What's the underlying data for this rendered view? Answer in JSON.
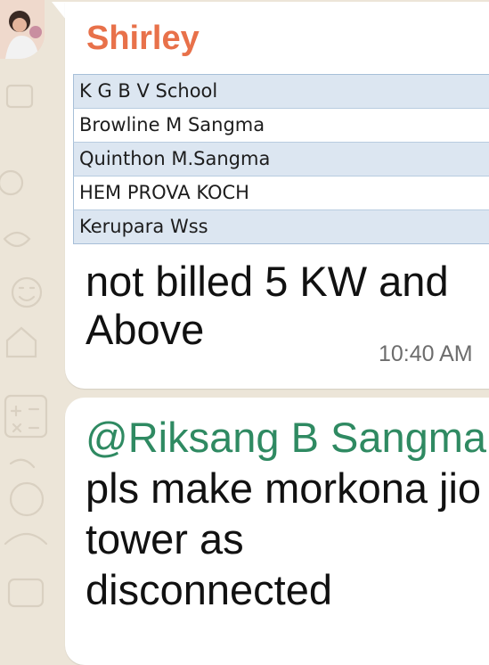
{
  "chat": {
    "sender_avatar_icon": "avatar-photo",
    "message1": {
      "sender": "Shirley",
      "sender_color": "#e8714a",
      "table_rows": [
        "K G B V School",
        "Browline M Sangma",
        "Quinthon M.Sangma",
        "HEM PROVA KOCH",
        "Kerupara Wss"
      ],
      "text": "not billed 5 KW and Above",
      "time": "10:40 AM"
    },
    "message2": {
      "mention": "@Riksang B Sangma",
      "mention_color": "#2f8a62",
      "text": " pls make morkona jio tower as disconnected"
    }
  }
}
